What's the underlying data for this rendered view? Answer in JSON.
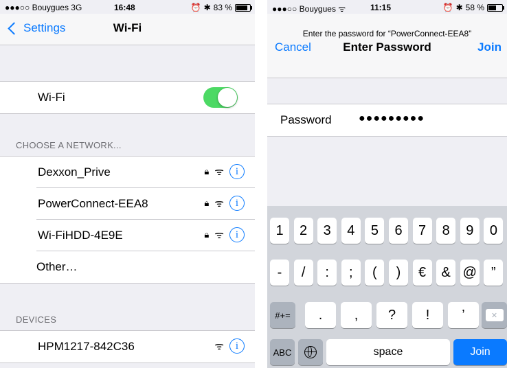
{
  "left": {
    "status": {
      "carrier": "●●●○○ Bouygues  3G",
      "time": "16:48",
      "battery_text": "83 %",
      "battery_level": 0.83
    },
    "nav": {
      "back_label": "Settings",
      "title": "Wi-Fi"
    },
    "wifi_row": {
      "label": "Wi-Fi",
      "enabled": true
    },
    "choose_header": "CHOOSE A NETWORK...",
    "networks": [
      {
        "name": "Dexxon_Prive",
        "locked": true
      },
      {
        "name": "PowerConnect-EEA8",
        "locked": true
      },
      {
        "name": "Wi-FiHDD-4E9E",
        "locked": true
      }
    ],
    "other_label": "Other…",
    "devices_header": "DEVICES",
    "devices": [
      {
        "name": "HPM1217-842C36",
        "locked": false
      }
    ]
  },
  "right": {
    "status": {
      "carrier": "●●●○○ Bouygues ᯤ",
      "time": "11:15",
      "battery_text": "58 %",
      "battery_level": 0.58
    },
    "prompt": "Enter the password for “PowerConnect-EEA8”",
    "cancel_label": "Cancel",
    "title": "Enter Password",
    "join_label": "Join",
    "password_label": "Password",
    "password_dots": "●●●●●●●●●",
    "keyboard": {
      "row1": [
        "1",
        "2",
        "3",
        "4",
        "5",
        "6",
        "7",
        "8",
        "9",
        "0"
      ],
      "row2": [
        "-",
        "/",
        ":",
        ";",
        "(",
        ")",
        "€",
        "&",
        "@",
        "”"
      ],
      "shift_label": "#+=",
      "row3": [
        ".",
        ",",
        "?",
        "!",
        "’"
      ],
      "abc_label": "ABC",
      "space_label": "space",
      "join_label": "Join"
    }
  },
  "colors": {
    "accent": "#0a7aff",
    "toggle_on": "#4cd964",
    "background": "#efeff4"
  },
  "icons": {
    "lock": "lock-icon",
    "wifi": "wifi-icon",
    "info": "info-icon",
    "globe": "globe-icon",
    "delete": "delete-icon"
  }
}
